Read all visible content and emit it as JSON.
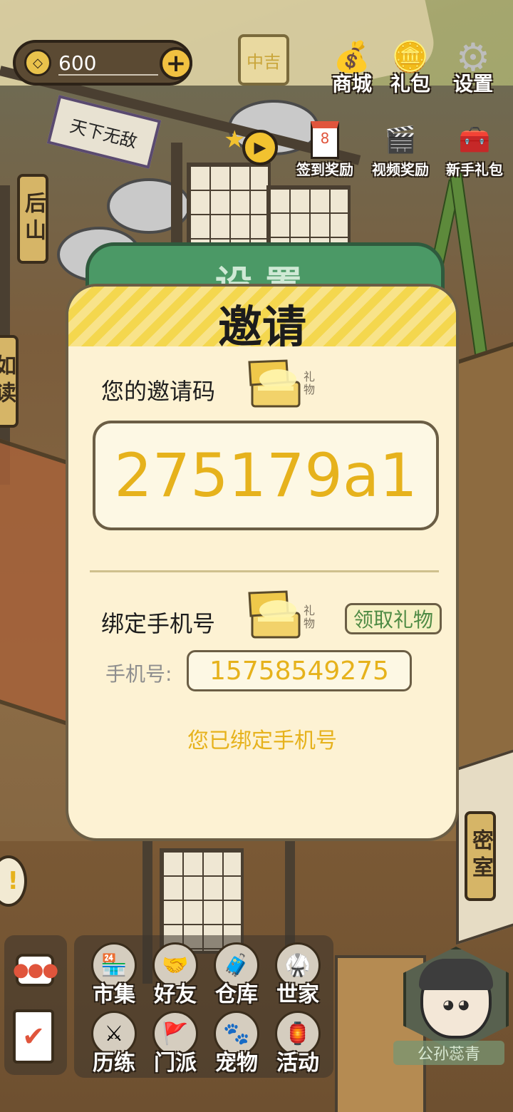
{
  "hud": {
    "coins": "600",
    "coin_icon": "coin-icon",
    "fortune": "中吉",
    "shop_label": "商城",
    "recharge_label": "礼包",
    "settings_label": "设置"
  },
  "rewards": {
    "checkin_label": "签到奖励",
    "checkin_day": "8",
    "video_label": "视频奖励",
    "newbie_label": "新手礼包"
  },
  "side": {
    "backhill": "后山",
    "secret_room": "密室",
    "left_partial": "如读"
  },
  "settings_panel": {
    "title": "设置"
  },
  "invite": {
    "title": "邀请",
    "code_label": "您的邀请码",
    "gift_tag": "礼物",
    "code": "275179a1",
    "bind_label": "绑定手机号",
    "claim_button": "领取礼物",
    "phone_label": "手机号:",
    "phone_number": "15758549275",
    "bound_message": "您已绑定手机号"
  },
  "menu": {
    "items": [
      {
        "label": "市集",
        "icon": "market-icon"
      },
      {
        "label": "好友",
        "icon": "handshake-icon"
      },
      {
        "label": "仓库",
        "icon": "chest-icon"
      },
      {
        "label": "世家",
        "icon": "robe-icon"
      },
      {
        "label": "历练",
        "icon": "swords-icon"
      },
      {
        "label": "门派",
        "icon": "banner-icon"
      },
      {
        "label": "宠物",
        "icon": "paw-icon"
      },
      {
        "label": "活动",
        "icon": "lantern-icon"
      }
    ]
  },
  "player": {
    "name": "公孙蕊青"
  },
  "colors": {
    "accent_yellow": "#e6b21c",
    "dialog_bg": "#fdf2d3",
    "settings_green": "#4b9966",
    "claim_green": "#4e8a44"
  }
}
